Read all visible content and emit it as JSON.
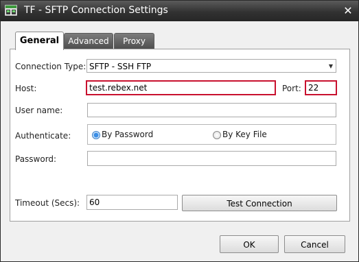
{
  "window": {
    "title": "TF - SFTP Connection Settings",
    "close_glyph": "✕",
    "app_icon": "connection-icon"
  },
  "tabs": [
    {
      "label": "General",
      "active": true
    },
    {
      "label": "Advanced",
      "active": false
    },
    {
      "label": "Proxy",
      "active": false
    }
  ],
  "form": {
    "connection_type_label": "Connection Type:",
    "connection_type_value": "SFTP - SSH FTP",
    "host_label": "Host:",
    "host_value": "test.rebex.net",
    "port_label": "Port:",
    "port_value": "22",
    "username_label": "User name:",
    "username_value": "",
    "authenticate_label": "Authenticate:",
    "auth_options": [
      {
        "label": "By Password",
        "checked": true
      },
      {
        "label": "By Key File",
        "checked": false
      }
    ],
    "password_label": "Password:",
    "password_value": "",
    "timeout_label": "Timeout (Secs):",
    "timeout_value": "60",
    "test_connection_label": "Test Connection"
  },
  "footer": {
    "ok_label": "OK",
    "cancel_label": "Cancel"
  },
  "colors": {
    "highlight": "#c8102e",
    "title_bar": "#333333",
    "radio_checked": "#3a8ee6"
  }
}
